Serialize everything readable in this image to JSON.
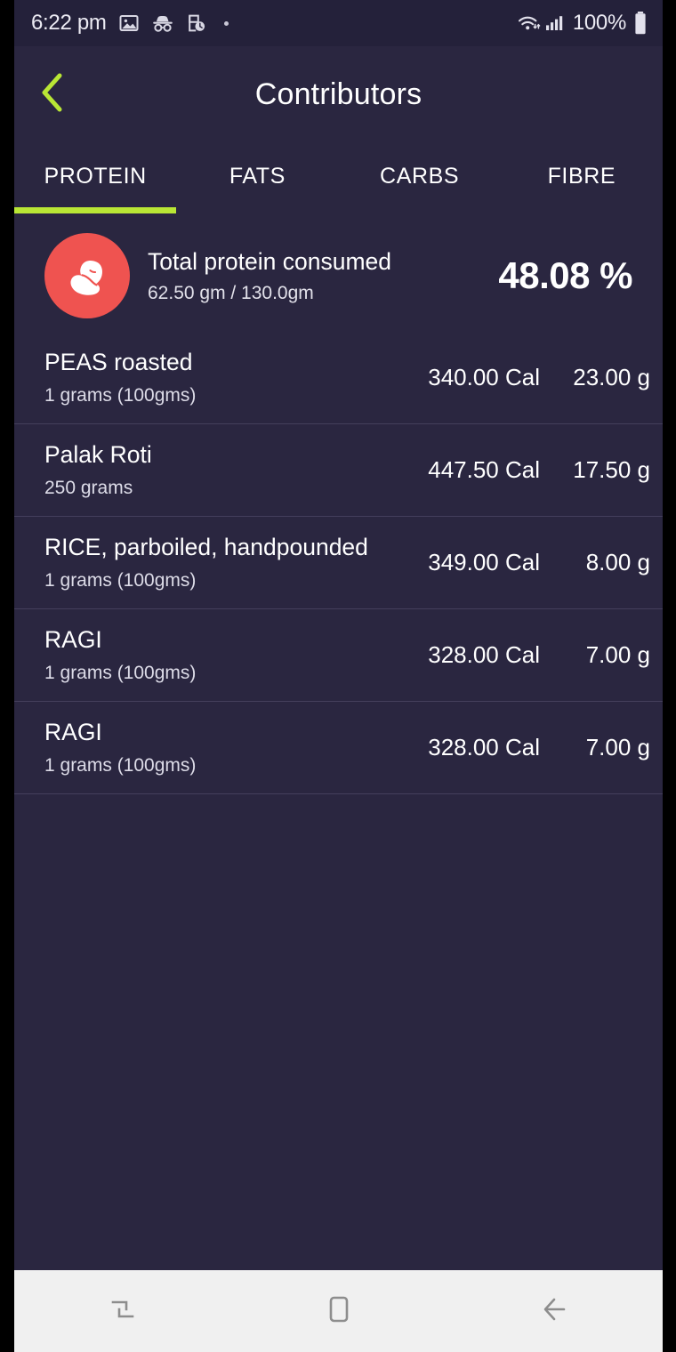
{
  "statusbar": {
    "time": "6:22 pm",
    "battery_percent": "100%",
    "icons": [
      "image-icon",
      "incognito-icon",
      "document-clock-icon",
      "dot-indicator-icon",
      "wifi-icon",
      "cellular-signal-icon",
      "battery-icon"
    ]
  },
  "header": {
    "title": "Contributors",
    "back_icon": "chevron-left-icon",
    "accent_color": "#b9e635"
  },
  "tabs": {
    "active_index": 0,
    "items": [
      {
        "label": "PROTEIN"
      },
      {
        "label": "FATS"
      },
      {
        "label": "CARBS"
      },
      {
        "label": "FIBRE"
      }
    ]
  },
  "summary": {
    "icon": "bean-icon",
    "icon_bg_color": "#ef5350",
    "title": "Total protein consumed",
    "subtitle": "62.50 gm / 130.0gm",
    "percent": "48.08 %"
  },
  "list": {
    "rows": [
      {
        "name": "PEAS roasted",
        "quantity": "1 grams (100gms)",
        "calories": "340.00 Cal",
        "grams": "23.00 g"
      },
      {
        "name": "Palak Roti",
        "quantity": "250 grams",
        "calories": "447.50 Cal",
        "grams": "17.50 g"
      },
      {
        "name": "RICE, parboiled, handpounded",
        "quantity": "1 grams (100gms)",
        "calories": "349.00 Cal",
        "grams": "8.00 g"
      },
      {
        "name": "RAGI",
        "quantity": "1 grams (100gms)",
        "calories": "328.00 Cal",
        "grams": "7.00 g"
      },
      {
        "name": "RAGI",
        "quantity": "1 grams (100gms)",
        "calories": "328.00 Cal",
        "grams": "7.00 g"
      }
    ]
  },
  "navbar": {
    "recents_icon": "recents-icon",
    "home_icon": "home-icon",
    "back_icon": "back-arrow-icon"
  }
}
